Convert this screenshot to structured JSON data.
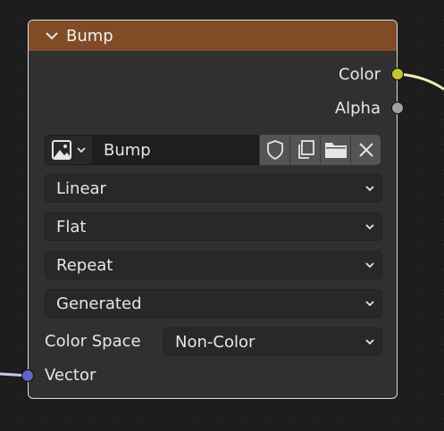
{
  "node": {
    "title": "Bump",
    "header_color": "#804b25",
    "outputs": [
      {
        "label": "Color",
        "socket_color": "#c7c729"
      },
      {
        "label": "Alpha",
        "socket_color": "#a1a1a1"
      }
    ],
    "image": {
      "type_icon": "image-icon",
      "name": "Bump",
      "buttons": [
        "shield-icon",
        "duplicate-icon",
        "folder-icon",
        "close-icon"
      ]
    },
    "dropdowns": [
      {
        "value": "Linear"
      },
      {
        "value": "Flat"
      },
      {
        "value": "Repeat"
      },
      {
        "value": "Generated"
      }
    ],
    "color_space": {
      "label": "Color Space",
      "value": "Non-Color"
    },
    "inputs": [
      {
        "label": "Vector",
        "socket_color": "#6363c7"
      }
    ]
  }
}
